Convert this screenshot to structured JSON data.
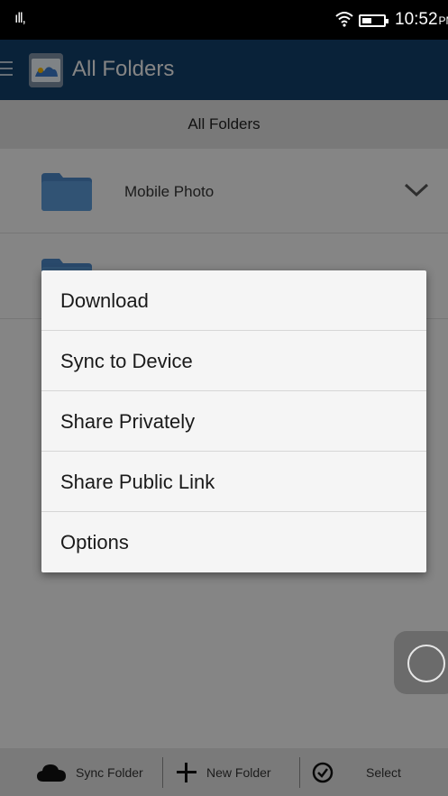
{
  "status_bar": {
    "signal": "ıll,",
    "time": "10:52",
    "ampm": "PM"
  },
  "app_bar": {
    "title": "All Folders"
  },
  "section_header": {
    "title": "All Folders"
  },
  "folders": [
    {
      "name": "Mobile Photo"
    }
  ],
  "popup_menu": {
    "items": [
      {
        "label": "Download"
      },
      {
        "label": "Sync to Device"
      },
      {
        "label": "Share Privately"
      },
      {
        "label": "Share Public Link"
      },
      {
        "label": "Options"
      }
    ]
  },
  "bottom_bar": {
    "sync_folder": "Sync Folder",
    "new_folder": "New Folder",
    "select": "Select"
  },
  "colors": {
    "app_bar": "#123e68",
    "folder_icon": "#4b86c4"
  }
}
